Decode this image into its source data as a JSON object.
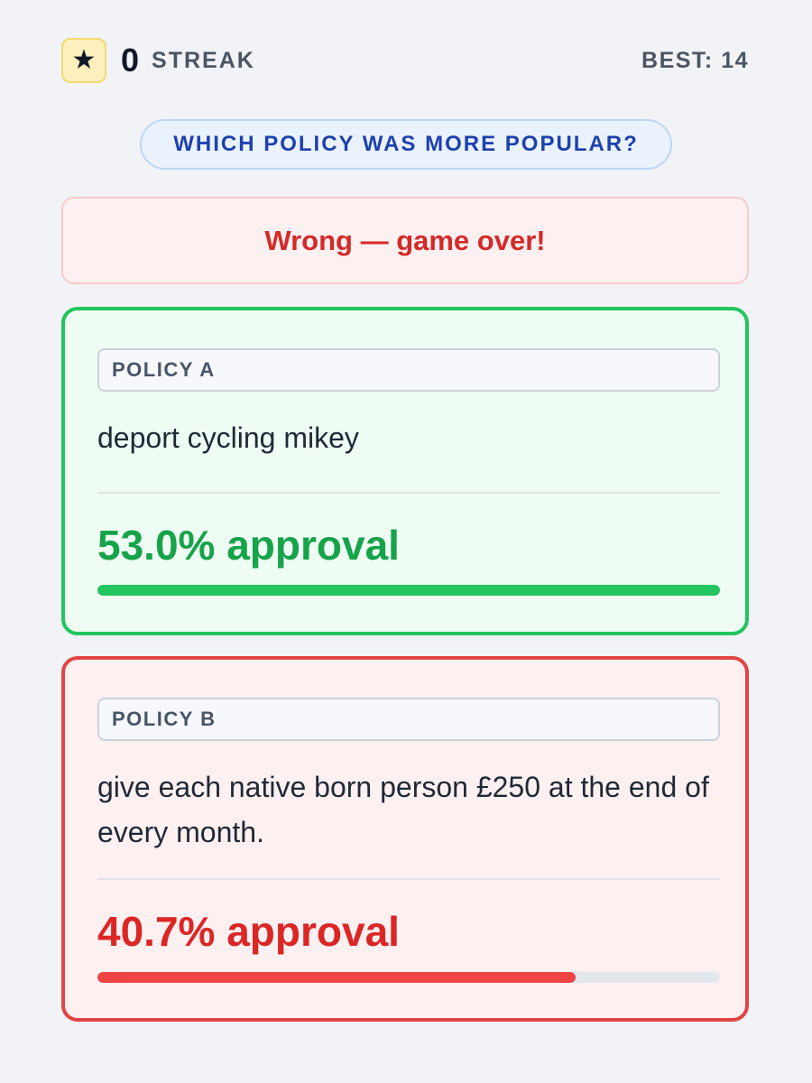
{
  "header": {
    "star_glyph": "★",
    "streak_count": "0",
    "streak_label": "STREAK",
    "best": "BEST: 14"
  },
  "question": "WHICH POLICY WAS MORE POPULAR?",
  "result": "Wrong — game over!",
  "policies": [
    {
      "tag": "POLICY A",
      "text": "deport cycling mikey",
      "approval_label": "53.0% approval",
      "bar_fraction": 1.0,
      "color": "#22c55e"
    },
    {
      "tag": "POLICY B",
      "text": "give each native born person £250 at the end of every month.",
      "approval_label": "40.7% approval",
      "bar_fraction": 0.768,
      "color": "#ef4444"
    }
  ]
}
